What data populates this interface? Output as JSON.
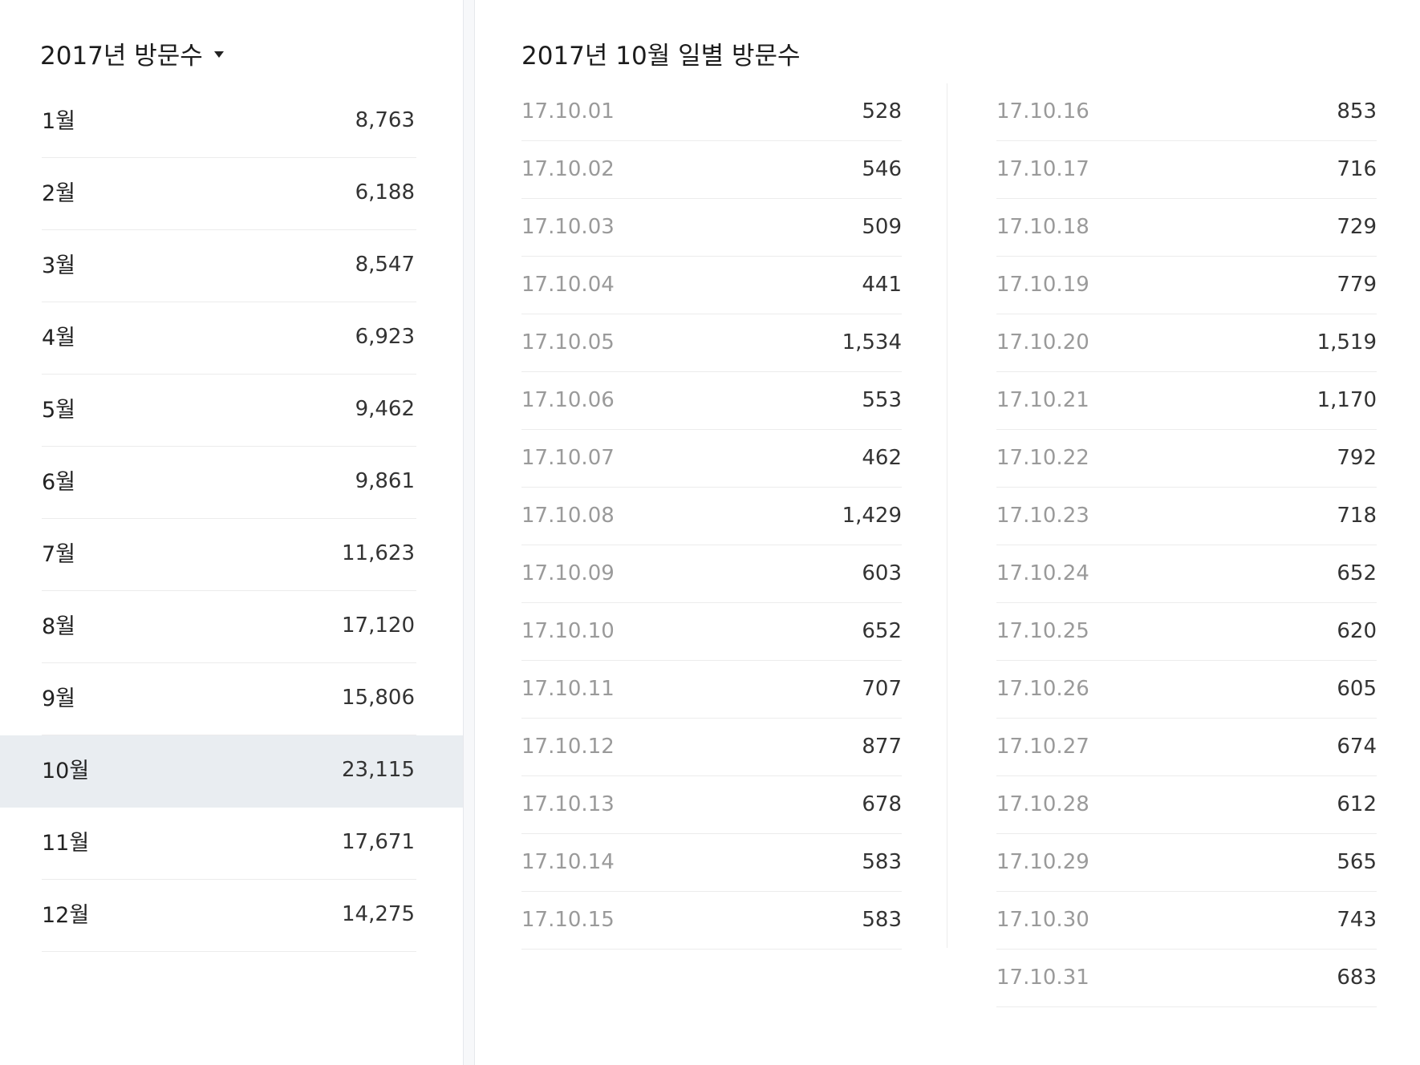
{
  "left": {
    "title": "2017년 방문수",
    "months": [
      {
        "label": "1월",
        "value": "8,763"
      },
      {
        "label": "2월",
        "value": "6,188"
      },
      {
        "label": "3월",
        "value": "8,547"
      },
      {
        "label": "4월",
        "value": "6,923"
      },
      {
        "label": "5월",
        "value": "9,462"
      },
      {
        "label": "6월",
        "value": "9,861"
      },
      {
        "label": "7월",
        "value": "11,623"
      },
      {
        "label": "8월",
        "value": "17,120"
      },
      {
        "label": "9월",
        "value": "15,806"
      },
      {
        "label": "10월",
        "value": "23,115",
        "selected": true
      },
      {
        "label": "11월",
        "value": "17,671"
      },
      {
        "label": "12월",
        "value": "14,275"
      }
    ]
  },
  "right": {
    "title": "2017년 10월 일별 방문수",
    "column1": [
      {
        "date": "17.10.01",
        "value": "528"
      },
      {
        "date": "17.10.02",
        "value": "546"
      },
      {
        "date": "17.10.03",
        "value": "509"
      },
      {
        "date": "17.10.04",
        "value": "441"
      },
      {
        "date": "17.10.05",
        "value": "1,534"
      },
      {
        "date": "17.10.06",
        "value": "553"
      },
      {
        "date": "17.10.07",
        "value": "462"
      },
      {
        "date": "17.10.08",
        "value": "1,429"
      },
      {
        "date": "17.10.09",
        "value": "603"
      },
      {
        "date": "17.10.10",
        "value": "652"
      },
      {
        "date": "17.10.11",
        "value": "707"
      },
      {
        "date": "17.10.12",
        "value": "877"
      },
      {
        "date": "17.10.13",
        "value": "678"
      },
      {
        "date": "17.10.14",
        "value": "583"
      },
      {
        "date": "17.10.15",
        "value": "583"
      }
    ],
    "column2": [
      {
        "date": "17.10.16",
        "value": "853"
      },
      {
        "date": "17.10.17",
        "value": "716"
      },
      {
        "date": "17.10.18",
        "value": "729"
      },
      {
        "date": "17.10.19",
        "value": "779"
      },
      {
        "date": "17.10.20",
        "value": "1,519"
      },
      {
        "date": "17.10.21",
        "value": "1,170"
      },
      {
        "date": "17.10.22",
        "value": "792"
      },
      {
        "date": "17.10.23",
        "value": "718"
      },
      {
        "date": "17.10.24",
        "value": "652"
      },
      {
        "date": "17.10.25",
        "value": "620"
      },
      {
        "date": "17.10.26",
        "value": "605"
      },
      {
        "date": "17.10.27",
        "value": "674"
      },
      {
        "date": "17.10.28",
        "value": "612"
      },
      {
        "date": "17.10.29",
        "value": "565"
      },
      {
        "date": "17.10.30",
        "value": "743"
      },
      {
        "date": "17.10.31",
        "value": "683"
      }
    ]
  },
  "colors": {
    "selected_row_bg": "#e9edf1",
    "date_text": "#9a9a9a",
    "divider": "#ececec"
  },
  "icons": {
    "year_dropdown": "caret-down-icon"
  }
}
